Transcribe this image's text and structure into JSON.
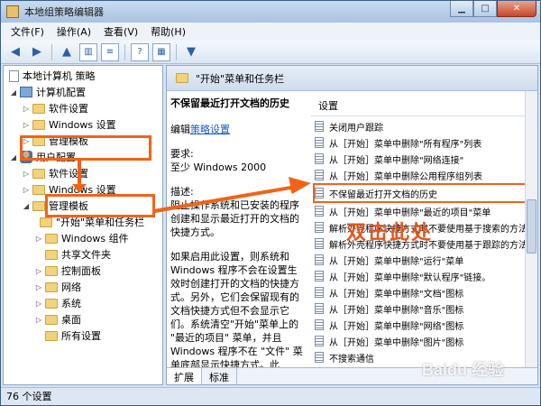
{
  "window": {
    "title": "本地组策略编辑器"
  },
  "menu": [
    "文件(F)",
    "操作(A)",
    "查看(V)",
    "帮助(H)"
  ],
  "tree": {
    "items": [
      {
        "label": "本地计算机 策略",
        "kind": "doc"
      },
      {
        "label": "计算机配置",
        "kind": "node"
      },
      {
        "label": "软件设置",
        "kind": "folder"
      },
      {
        "label": "Windows 设置",
        "kind": "folder"
      },
      {
        "label": "管理模板",
        "kind": "folder"
      },
      {
        "label": "用户配置",
        "kind": "person"
      },
      {
        "label": "软件设置",
        "kind": "folder"
      },
      {
        "label": "Windows 设置",
        "kind": "folder"
      },
      {
        "label": "管理模板",
        "kind": "folder"
      },
      {
        "label": "\"开始\"菜单和任务栏",
        "kind": "folder"
      },
      {
        "label": "Windows 组件",
        "kind": "folder"
      },
      {
        "label": "共享文件夹",
        "kind": "folder"
      },
      {
        "label": "控制面板",
        "kind": "folder"
      },
      {
        "label": "网络",
        "kind": "folder"
      },
      {
        "label": "系统",
        "kind": "folder"
      },
      {
        "label": "桌面",
        "kind": "folder"
      },
      {
        "label": "所有设置",
        "kind": "folder"
      }
    ]
  },
  "right_header": "\"开始\"菜单和任务栏",
  "description": {
    "title": "不保留最近打开文档的历史",
    "edit_prefix": "编辑",
    "edit_link": "策略设置",
    "req_label": "要求:",
    "req_value": "至少 Windows 2000",
    "desc_label": "描述:",
    "desc_text": "阻止操作系统和已安装的程序创建和显示最近打开的文档的快捷方式。",
    "desc_more": "如果启用此设置，则系统和 Windows 程序不会在设置生效时创建打开的文档的快捷方式。另外，它们会保留现有的文档快捷方式但不会显示它们。系统清空\"开始\"菜单上的 \"最近的项目\" 菜单，并且 Windows 程序不在 \"文件\" 菜单底部显示快捷方式。此外，\"开始\" 菜单和任务栏中的跳"
  },
  "list": {
    "header": "设置",
    "rows": [
      "关闭用户跟踪",
      "从［开始］菜单中删除\"所有程序\"列表",
      "从［开始］菜单中删除\"网络连接\"",
      "从［开始］菜单中删除公用程序组列表",
      "不保留最近打开文档的历史",
      "从［开始］菜单中删除\"最近的项目\"菜单",
      "解析外壳程序快捷方式时不要使用基于搜索的方法",
      "解析外壳程序快捷方式时不要使用基于跟踪的方法",
      "从［开始］菜单中删除\"运行\"菜单",
      "从［开始］菜单中删除\"默认程序\"链接。",
      "从［开始］菜单中删除\"文档\"图标",
      "从［开始］菜单中删除\"音乐\"图标",
      "从［开始］菜单中删除\"网络\"图标",
      "从［开始］菜单中删除\"图片\"图标",
      "不搜索通信"
    ]
  },
  "tabs": [
    "扩展",
    "标准"
  ],
  "status": "76 个设置",
  "annotation": "双击此处",
  "watermark": "Baidu 经验",
  "accent": "#f06419"
}
